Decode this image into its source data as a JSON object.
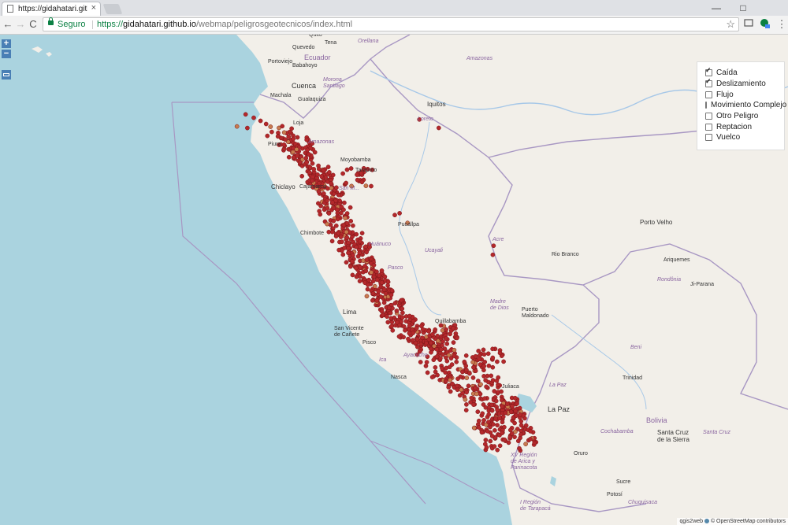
{
  "browser": {
    "tab_title": "https://gidahatari.github.i",
    "tab_close": "×",
    "url_scheme": "https://",
    "url_host": "gidahatari.github.io",
    "url_path": "/webmap/peligrosgeotecnicos/index.html",
    "secure_label": "Seguro",
    "back_icon": "←",
    "forward_icon": "→",
    "reload_icon": "C",
    "star_icon": "☆",
    "menu_icon": "⋮",
    "minimize": "—",
    "maximize": "□"
  },
  "map": {
    "zoom_in": "+",
    "zoom_out": "−",
    "colors": {
      "ocean": "#aad3df",
      "land": "#f2efe9",
      "border": "#a897c3",
      "river": "#a7c8e8",
      "point": "#b3282b",
      "point_stroke": "#7a1517",
      "point_alt": "#c77b4f"
    },
    "legend": [
      {
        "label": "Caída",
        "checked": true
      },
      {
        "label": "Deslizamiento",
        "checked": true
      },
      {
        "label": "Flujo",
        "checked": false
      },
      {
        "label": "Movimiento Complejo",
        "checked": false
      },
      {
        "label": "Otro Peligro",
        "checked": false
      },
      {
        "label": "Reptacion",
        "checked": false
      },
      {
        "label": "Vuelco",
        "checked": false
      }
    ],
    "places": {
      "quito": "Quito",
      "tena": "Tena",
      "orellana": "Orellana",
      "quevedo": "Quevedo",
      "babahoyo": "Babahoyo",
      "portoviejo": "Portoviejo",
      "ecuador": "Ecuador",
      "amazonas": "Amazonas",
      "cuenca": "Cuenca",
      "morona": "Morona\nSantiago",
      "machala": "Machala",
      "gualaquiza": "Gualaquiza",
      "iquitos": "Iquitos",
      "loreto": "Loreto",
      "loja": "Loja",
      "piura": "Piura",
      "amazonas_pe": "Amazonas",
      "moyobamba": "Moyobamba",
      "tarapoto": "Tarapoto",
      "chiclayo": "Chiclayo",
      "cajamarca": "Cajamarca",
      "san_martin": "San M...",
      "pucallpa": "Pucallpa",
      "chimbote": "Chimbote",
      "huanuco": "Huánuco",
      "ucayali": "Ucayali",
      "acre": "Acre",
      "rio_branco": "Rio Branco",
      "porto_velho": "Porto Velho",
      "ariquemes": "Ariquemes",
      "rondonia": "Rondônia",
      "ji_parana": "Ji-Parana",
      "pasco": "Pasco",
      "lima": "Lima",
      "madre_de_dios": "Madre\nde Dios",
      "puerto_maldonado": "Puerto\nMaldonado",
      "san_vicente": "San Vicente\nde Cañete",
      "quillabamba": "Quillabamba",
      "pisco": "Pisco",
      "ica": "Ica",
      "ayacucho": "Ayacucho",
      "beni": "Beni",
      "nasca": "Nasca",
      "trinidad": "Trinidad",
      "juliaca": "Juliaca",
      "la_paz_region": "La Paz",
      "la_paz": "La Paz",
      "bolivia": "Bolivia",
      "cochabamba": "Cochabamba",
      "santa_cruz": "Santa Cruz\nde la Sierra",
      "santa_cruz_region": "Santa Cruz",
      "oruro": "Oruro",
      "arica": "XV Región\nde Arica y\nParinacota",
      "sucre": "Sucre",
      "potosi": "Potosí",
      "chuquisaca": "Chuquisaca",
      "i_region": "I Región\nde Tarapacá"
    },
    "attribution": "qgis2web",
    "attribution_osm": "© OpenStreetMap contributors"
  }
}
